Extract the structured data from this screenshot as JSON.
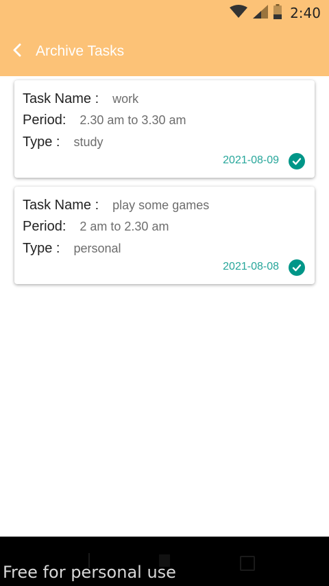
{
  "status_bar": {
    "time": "2:40",
    "icons": [
      "wifi-icon",
      "signal-icon",
      "battery-icon"
    ]
  },
  "appbar": {
    "back_icon": "chevron-left-icon",
    "title": "Archive Tasks"
  },
  "labels": {
    "task_name": "Task Name :",
    "period": "Period:",
    "type": "Type :"
  },
  "tasks": [
    {
      "name": "work",
      "period": "2.30 am to 3.30 am",
      "type": "study",
      "date": "2021-08-09",
      "status_icon": "check-circle-icon"
    },
    {
      "name": "play some games",
      "period": "2 am to 2.30 am",
      "type": "personal",
      "date": "2021-08-08",
      "status_icon": "check-circle-icon"
    }
  ],
  "navbar": {
    "buttons": [
      "back-icon",
      "home-icon",
      "recents-icon"
    ]
  },
  "watermark": "Free for personal use",
  "colors": {
    "header": "#fcc277",
    "accent_teal": "#009688",
    "date_teal": "#26a69a"
  }
}
